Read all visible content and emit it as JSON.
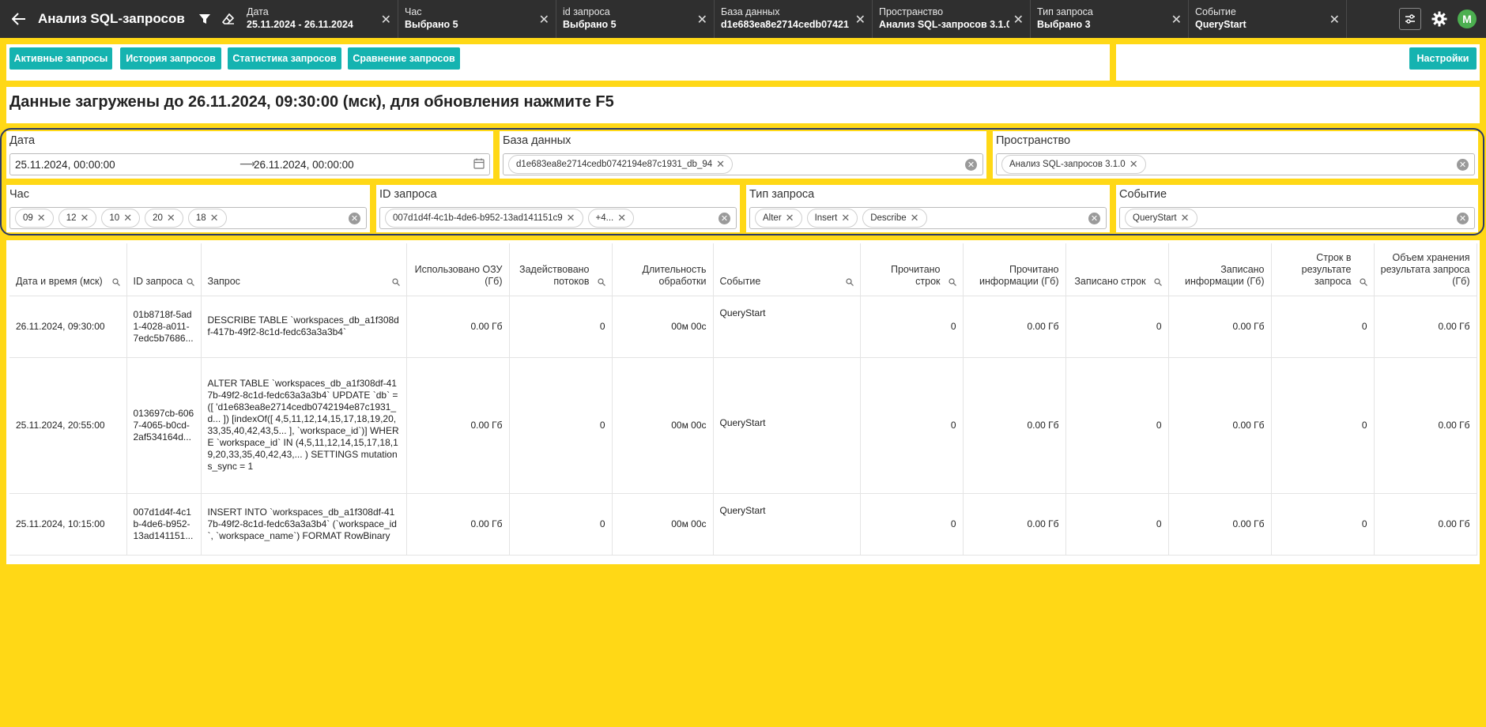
{
  "app": {
    "title": "Анализ SQL-запросов",
    "avatar": "M"
  },
  "header_filters": [
    {
      "label": "Дата",
      "value": "25.11.2024 - 26.11.2024"
    },
    {
      "label": "Час",
      "value": "Выбрано 5"
    },
    {
      "label": "id запроса",
      "value": "Выбрано 5"
    },
    {
      "label": "База данных",
      "value": "d1e683ea8e2714cedb07421"
    },
    {
      "label": "Пространство",
      "value": "Анализ SQL-запросов 3.1.0"
    },
    {
      "label": "Тип запроса",
      "value": "Выбрано 3"
    },
    {
      "label": "Событие",
      "value": "QueryStart"
    }
  ],
  "nav_buttons": {
    "active": "Активные запросы",
    "history": "История запросов",
    "stats": "Статистика запросов",
    "compare": "Сравнение запросов",
    "settings": "Настройки"
  },
  "info_text": "Данные загружены до 26.11.2024, 09:30:00 (мск), для обновления нажмите F5",
  "filters": {
    "date": {
      "label": "Дата",
      "from": "25.11.2024, 00:00:00",
      "to": "26.11.2024, 00:00:00"
    },
    "database": {
      "label": "База данных",
      "tags": [
        "d1e683ea8e2714cedb0742194e87c1931_db_94"
      ]
    },
    "space": {
      "label": "Пространство",
      "tags": [
        "Анализ SQL-запросов 3.1.0"
      ]
    },
    "hour": {
      "label": "Час",
      "tags": [
        "09",
        "12",
        "10",
        "20",
        "18"
      ]
    },
    "query_id": {
      "label": "ID запроса",
      "tags": [
        "007d1d4f-4c1b-4de6-b952-13ad141151c9",
        "+4..."
      ]
    },
    "query_type": {
      "label": "Тип запроса",
      "tags": [
        "Alter",
        "Insert",
        "Describe"
      ]
    },
    "event": {
      "label": "Событие",
      "tags": [
        "QueryStart"
      ]
    }
  },
  "table": {
    "columns": [
      "Дата и время (мск)",
      "ID запроса",
      "Запрос",
      "Использовано ОЗУ (Гб)",
      "Задействовано потоков",
      "Длительность обработки",
      "Событие",
      "Прочитано строк",
      "Прочитано информации (Гб)",
      "Записано строк",
      "Записано информации (Гб)",
      "Строк в результате запроса",
      "Объем хранения результата запроса (Гб)"
    ],
    "rows": [
      {
        "datetime": "26.11.2024, 09:30:00",
        "id": "01b8718f-5ad1-4028-a011-7edc5b7686...",
        "query": "DESCRIBE TABLE `workspaces_db_a1f308df-417b-49f2-8c1d-fedc63a3a3b4`",
        "ram": "0.00 Гб",
        "threads": "0",
        "duration": "00м 00с",
        "event": "QueryStart",
        "read_rows": "0",
        "read_info": "0.00 Гб",
        "written_rows": "0",
        "written_info": "0.00 Гб",
        "result_rows": "0",
        "result_size": "0.00 Гб"
      },
      {
        "datetime": "25.11.2024, 20:55:00",
        "id": "013697cb-6067-4065-b0cd-2af534164d...",
        "query": "ALTER TABLE `workspaces_db_a1f308df-417b-49f2-8c1d-fedc63a3a3b4` UPDATE `db` = ([ 'd1e683ea8e2714cedb0742194e87c1931_d... ]) [indexOf([ 4,5,11,12,14,15,17,18,19,20,33,35,40,42,43,5... ], `workspace_id`)] WHERE `workspace_id` IN (4,5,11,12,14,15,17,18,19,20,33,35,40,42,43,... ) SETTINGS mutations_sync = 1",
        "ram": "0.00 Гб",
        "threads": "0",
        "duration": "00м 00с",
        "event": "QueryStart",
        "read_rows": "0",
        "read_info": "0.00 Гб",
        "written_rows": "0",
        "written_info": "0.00 Гб",
        "result_rows": "0",
        "result_size": "0.00 Гб"
      },
      {
        "datetime": "25.11.2024, 10:15:00",
        "id": "007d1d4f-4c1b-4de6-b952-13ad141151...",
        "query": "INSERT INTO `workspaces_db_a1f308df-417b-49f2-8c1d-fedc63a3a3b4` (`workspace_id`, `workspace_name`) FORMAT RowBinary",
        "ram": "0.00 Гб",
        "threads": "0",
        "duration": "00м 00с",
        "event": "QueryStart",
        "read_rows": "0",
        "read_info": "0.00 Гб",
        "written_rows": "0",
        "written_info": "0.00 Гб",
        "result_rows": "0",
        "result_size": "0.00 Гб"
      }
    ]
  }
}
